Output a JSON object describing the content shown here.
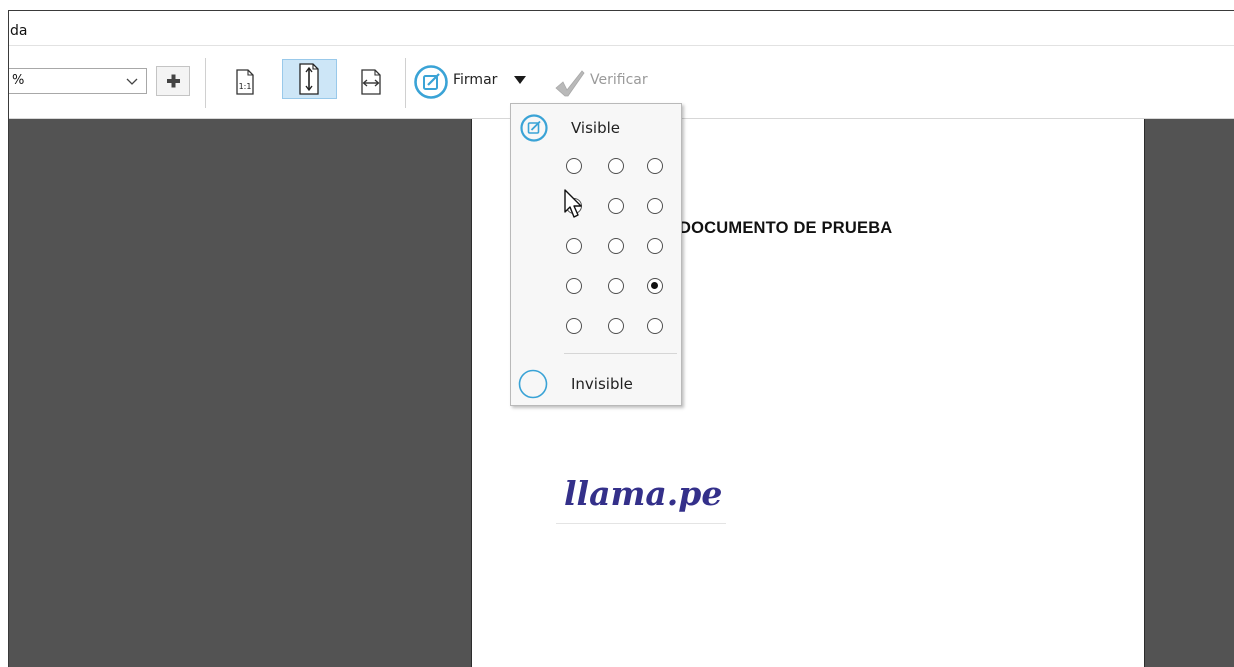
{
  "menubar": {
    "partial_item": "da"
  },
  "toolbar": {
    "zoom": {
      "value": "%"
    },
    "sign_label": "Firmar",
    "verify_label": "Verificar"
  },
  "icons": {
    "chevron": "chevron-down-icon",
    "zoom_in": "plus-icon",
    "actual_size": "actual-size-1-1-icon",
    "fit_height": "fit-height-icon",
    "fit_width": "fit-width-icon",
    "sign": "sign-pen-icon",
    "dropdown": "triangle-down-icon",
    "verify": "checkmark-icon",
    "cursor": "mouse-pointer-icon"
  },
  "document": {
    "title": "DOCUMENTO DE PRUEBA",
    "logo_text": "llama.pe"
  },
  "sign_dropdown": {
    "visible_label": "Visible",
    "invisible_label": "Invisible",
    "position_grid": {
      "rows": 5,
      "columns": 3,
      "selected": {
        "row": 4,
        "column": 3
      }
    }
  },
  "colors": {
    "accent": "#3aa3d6",
    "viewer_background": "#535353",
    "active_button": "#cde6f7",
    "logo": "#34308a"
  }
}
